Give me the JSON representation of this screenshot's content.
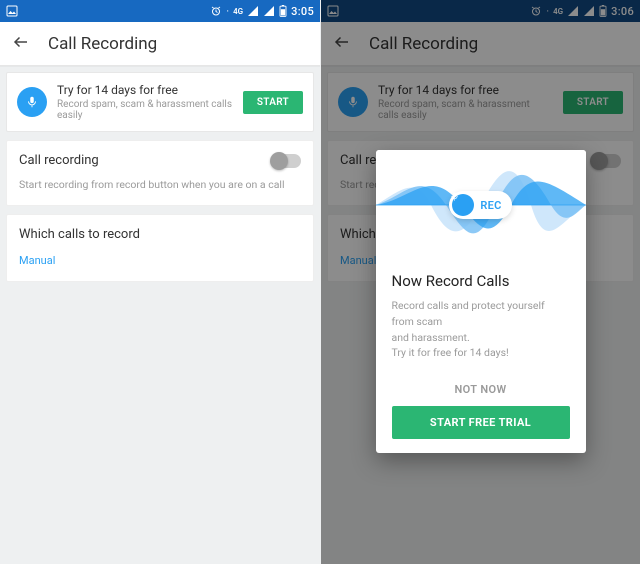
{
  "left": {
    "status": {
      "time": "3:05"
    },
    "appbar": {
      "title": "Call Recording"
    },
    "promo": {
      "title": "Try for 14 days for free",
      "subtitle": "Record spam, scam & harassment calls easily",
      "cta": "START"
    },
    "call_recording": {
      "title": "Call recording",
      "subtitle": "Start recording from record button when you are on a call",
      "enabled": false
    },
    "which_calls": {
      "title": "Which calls to record",
      "value": "Manual"
    }
  },
  "right": {
    "status": {
      "time": "3:06"
    },
    "appbar": {
      "title": "Call Recording"
    },
    "promo": {
      "title": "Try for 14 days for free",
      "subtitle": "Record spam, scam & harassment calls easily",
      "cta": "START"
    },
    "call_recording": {
      "title": "Call recording",
      "subtitle_truncated": "Start rec",
      "enabled": false
    },
    "which_calls": {
      "title_truncated": "Which c",
      "value": "Manual"
    },
    "dialog": {
      "rec_label": "REC",
      "title": "Now Record Calls",
      "desc_line1": "Record calls and protect yourself from scam",
      "desc_line2": "and harassment.",
      "desc_line3": "Try it for free for 14 days!",
      "not_now": "NOT NOW",
      "start_trial": "START FREE TRIAL"
    }
  },
  "colors": {
    "status_left": "#1769c1",
    "status_right": "#114a84",
    "accent_blue": "#2aa0f3",
    "cta_green": "#2bb673"
  }
}
